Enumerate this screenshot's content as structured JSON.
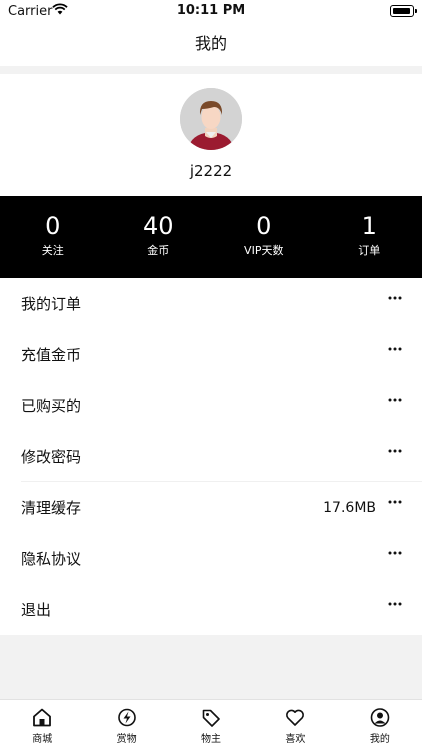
{
  "status_bar": {
    "carrier": "Carrier",
    "time": "10:11 PM"
  },
  "header": {
    "title": "我的"
  },
  "profile": {
    "username": "j2222"
  },
  "stats": [
    {
      "value": "0",
      "label": "关注"
    },
    {
      "value": "40",
      "label": "金币"
    },
    {
      "value": "0",
      "label": "VIP天数"
    },
    {
      "value": "1",
      "label": "订单"
    }
  ],
  "menu": {
    "items": [
      {
        "label": "我的订单"
      },
      {
        "label": "充值金币"
      },
      {
        "label": "已购买的"
      },
      {
        "label": "修改密码"
      },
      {
        "label": "清理缓存",
        "value": "17.6MB"
      },
      {
        "label": "隐私协议"
      },
      {
        "label": "退出"
      }
    ]
  },
  "tabbar": {
    "items": [
      {
        "label": "商城",
        "icon": "home-icon"
      },
      {
        "label": "赏物",
        "icon": "lightning-icon"
      },
      {
        "label": "物主",
        "icon": "tag-icon"
      },
      {
        "label": "喜欢",
        "icon": "heart-icon"
      },
      {
        "label": "我的",
        "icon": "user-icon"
      }
    ]
  }
}
